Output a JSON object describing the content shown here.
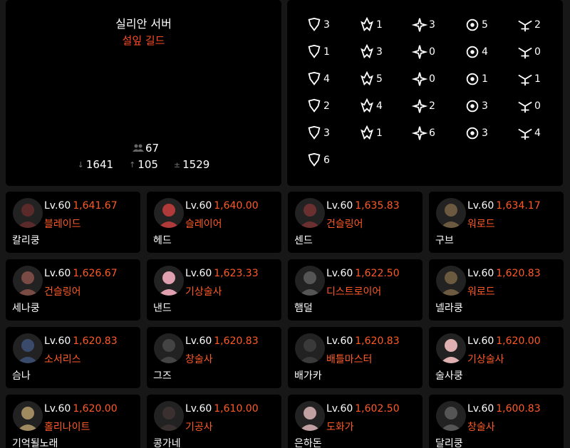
{
  "guild": {
    "server": "실리안 서버",
    "name": "설잎 길드",
    "member_count": "67",
    "stats": [
      {
        "icon": "arrow-down-icon",
        "glyph": "↓",
        "value": "1641"
      },
      {
        "icon": "arrow-up-icon",
        "glyph": "↑",
        "value": "105"
      },
      {
        "icon": "average-icon",
        "glyph": "±",
        "value": "1529"
      }
    ]
  },
  "classes": [
    {
      "icon": "berserker-emblem-icon",
      "count": "3"
    },
    {
      "icon": "destroyer-emblem-icon",
      "count": "1"
    },
    {
      "icon": "warlord-emblem-icon",
      "count": "3"
    },
    {
      "icon": "holyknight-emblem-icon",
      "count": "5"
    },
    {
      "icon": "slayer-emblem-icon",
      "count": "2"
    },
    {
      "icon": "striker-emblem-icon",
      "count": "1"
    },
    {
      "icon": "battlemaster-emblem-icon",
      "count": "3"
    },
    {
      "icon": "infighter-emblem-icon",
      "count": "0"
    },
    {
      "icon": "soulmaster-emblem-icon",
      "count": "4"
    },
    {
      "icon": "lancemaster-emblem-icon",
      "count": "0"
    },
    {
      "icon": "devilhunter-emblem-icon",
      "count": "4"
    },
    {
      "icon": "blaster-emblem-icon",
      "count": "5"
    },
    {
      "icon": "hawkeye-emblem-icon",
      "count": "0"
    },
    {
      "icon": "scouter-emblem-icon",
      "count": "1"
    },
    {
      "icon": "gunslinger-emblem-icon",
      "count": "1"
    },
    {
      "icon": "bard-emblem-icon",
      "count": "2"
    },
    {
      "icon": "summoner-emblem-icon",
      "count": "4"
    },
    {
      "icon": "arcana-emblem-icon",
      "count": "2"
    },
    {
      "icon": "sorceress-emblem-icon",
      "count": "3"
    },
    {
      "icon": "blade-emblem-icon",
      "count": "0"
    },
    {
      "icon": "demonic-emblem-icon",
      "count": "3"
    },
    {
      "icon": "reaper-emblem-icon",
      "count": "1"
    },
    {
      "icon": "souleater-emblem-icon",
      "count": "6"
    },
    {
      "icon": "artist-emblem-icon",
      "count": "3"
    },
    {
      "icon": "aeromancer-emblem-icon",
      "count": "4"
    },
    {
      "icon": "alchemist-emblem-icon",
      "count": "6"
    }
  ],
  "members": [
    {
      "level": "Lv.60",
      "score": "1,641.67",
      "class": "블레이드",
      "name": "칼리쿵",
      "avatar": "#5a2a2a"
    },
    {
      "level": "Lv.60",
      "score": "1,640.00",
      "class": "슬레이어",
      "name": "헤드",
      "avatar": "#b03a3a"
    },
    {
      "level": "Lv.60",
      "score": "1,635.83",
      "class": "건슬링어",
      "name": "센드",
      "avatar": "#6a3030"
    },
    {
      "level": "Lv.60",
      "score": "1,634.17",
      "class": "워로드",
      "name": "구브",
      "avatar": "#6b5a40"
    },
    {
      "level": "Lv.60",
      "score": "1,626.67",
      "class": "건슬링어",
      "name": "세나쿵",
      "avatar": "#7a4a44"
    },
    {
      "level": "Lv.60",
      "score": "1,623.33",
      "class": "기상술사",
      "name": "낸드",
      "avatar": "#e0a0b0"
    },
    {
      "level": "Lv.60",
      "score": "1,622.50",
      "class": "디스트로이어",
      "name": "햄덜",
      "avatar": "#555555"
    },
    {
      "level": "Lv.60",
      "score": "1,620.83",
      "class": "워로드",
      "name": "넬라쿵",
      "avatar": "#6b5a40"
    },
    {
      "level": "Lv.60",
      "score": "1,620.83",
      "class": "소서리스",
      "name": "슴나",
      "avatar": "#3a4a6a"
    },
    {
      "level": "Lv.60",
      "score": "1,620.83",
      "class": "창술사",
      "name": "그즈",
      "avatar": "#444444"
    },
    {
      "level": "Lv.60",
      "score": "1,620.83",
      "class": "배틀마스터",
      "name": "배가카",
      "avatar": "#3a3a3a"
    },
    {
      "level": "Lv.60",
      "score": "1,620.00",
      "class": "기상술사",
      "name": "술사쿵",
      "avatar": "#e0b0b0"
    },
    {
      "level": "Lv.60",
      "score": "1,620.00",
      "class": "홀리나이트",
      "name": "기억될노래",
      "avatar": "#a08a60"
    },
    {
      "level": "Lv.60",
      "score": "1,610.00",
      "class": "기공사",
      "name": "콩가네",
      "avatar": "#3a3030"
    },
    {
      "level": "Lv.60",
      "score": "1,602.50",
      "class": "도화가",
      "name": "은하돈",
      "avatar": "#c0a0a0"
    },
    {
      "level": "Lv.60",
      "score": "1,600.83",
      "class": "창술사",
      "name": "달리쿵",
      "avatar": "#555555"
    }
  ],
  "colors": {
    "accent": "#ff5a26",
    "guild": "#ff4b26",
    "panel": "#000000",
    "background": "#171717"
  }
}
